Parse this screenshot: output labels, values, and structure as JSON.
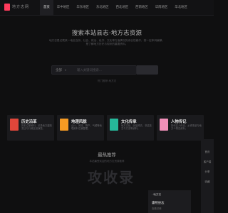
{
  "site": {
    "logo_text": "地方志网"
  },
  "nav": [
    {
      "label": "首页",
      "active": true
    },
    {
      "label": "华中地区",
      "active": false
    },
    {
      "label": "华东地区",
      "active": false
    },
    {
      "label": "东北地区",
      "active": false
    },
    {
      "label": "西北地区",
      "active": false
    },
    {
      "label": "西南地区",
      "active": false
    },
    {
      "label": "华南地区",
      "active": false
    },
    {
      "label": "华北地区",
      "active": false
    }
  ],
  "hero": {
    "title": "搜索本站县志·地方志资源",
    "subtitle": "地方志是记载某一地区自然、社会、政治、经济、文化等方面情况的综合性著作，按一定体例编纂，是了解地方历史与现状的重要资料。"
  },
  "search": {
    "category": "全部",
    "placeholder": "输入关键词搜索...",
    "hot_text": "热门推荐  地方志"
  },
  "cards": [
    {
      "title": "历史沿革",
      "desc": "历史沿革资料，记录地方建制变迁与行政区划演变。",
      "color": "#e0463a"
    },
    {
      "title": "地理风貌",
      "desc": "山川、河流、物产、气候等地理资料汇编整理。",
      "color": "#f59a23"
    },
    {
      "title": "文化传承",
      "desc": "地方文化、民俗风情、非遗技艺与方言等资料。",
      "color": "#26b89a"
    },
    {
      "title": "人物传记",
      "desc": "历代名人传记，乡贤事迹与地方人物志资料。",
      "color": "#f08fb8"
    }
  ],
  "recommend": {
    "title": "最热推荐",
    "subtitle": "本站最受欢迎的地方志资源推荐",
    "watermark": "攻收录",
    "card": {
      "tag": "· 地方志",
      "name": "康熙县志",
      "meta": "查看详情"
    }
  },
  "sidebar": [
    {
      "label": "首页"
    },
    {
      "label": "客户端"
    },
    {
      "label": "分享"
    },
    {
      "label": "收藏"
    }
  ]
}
